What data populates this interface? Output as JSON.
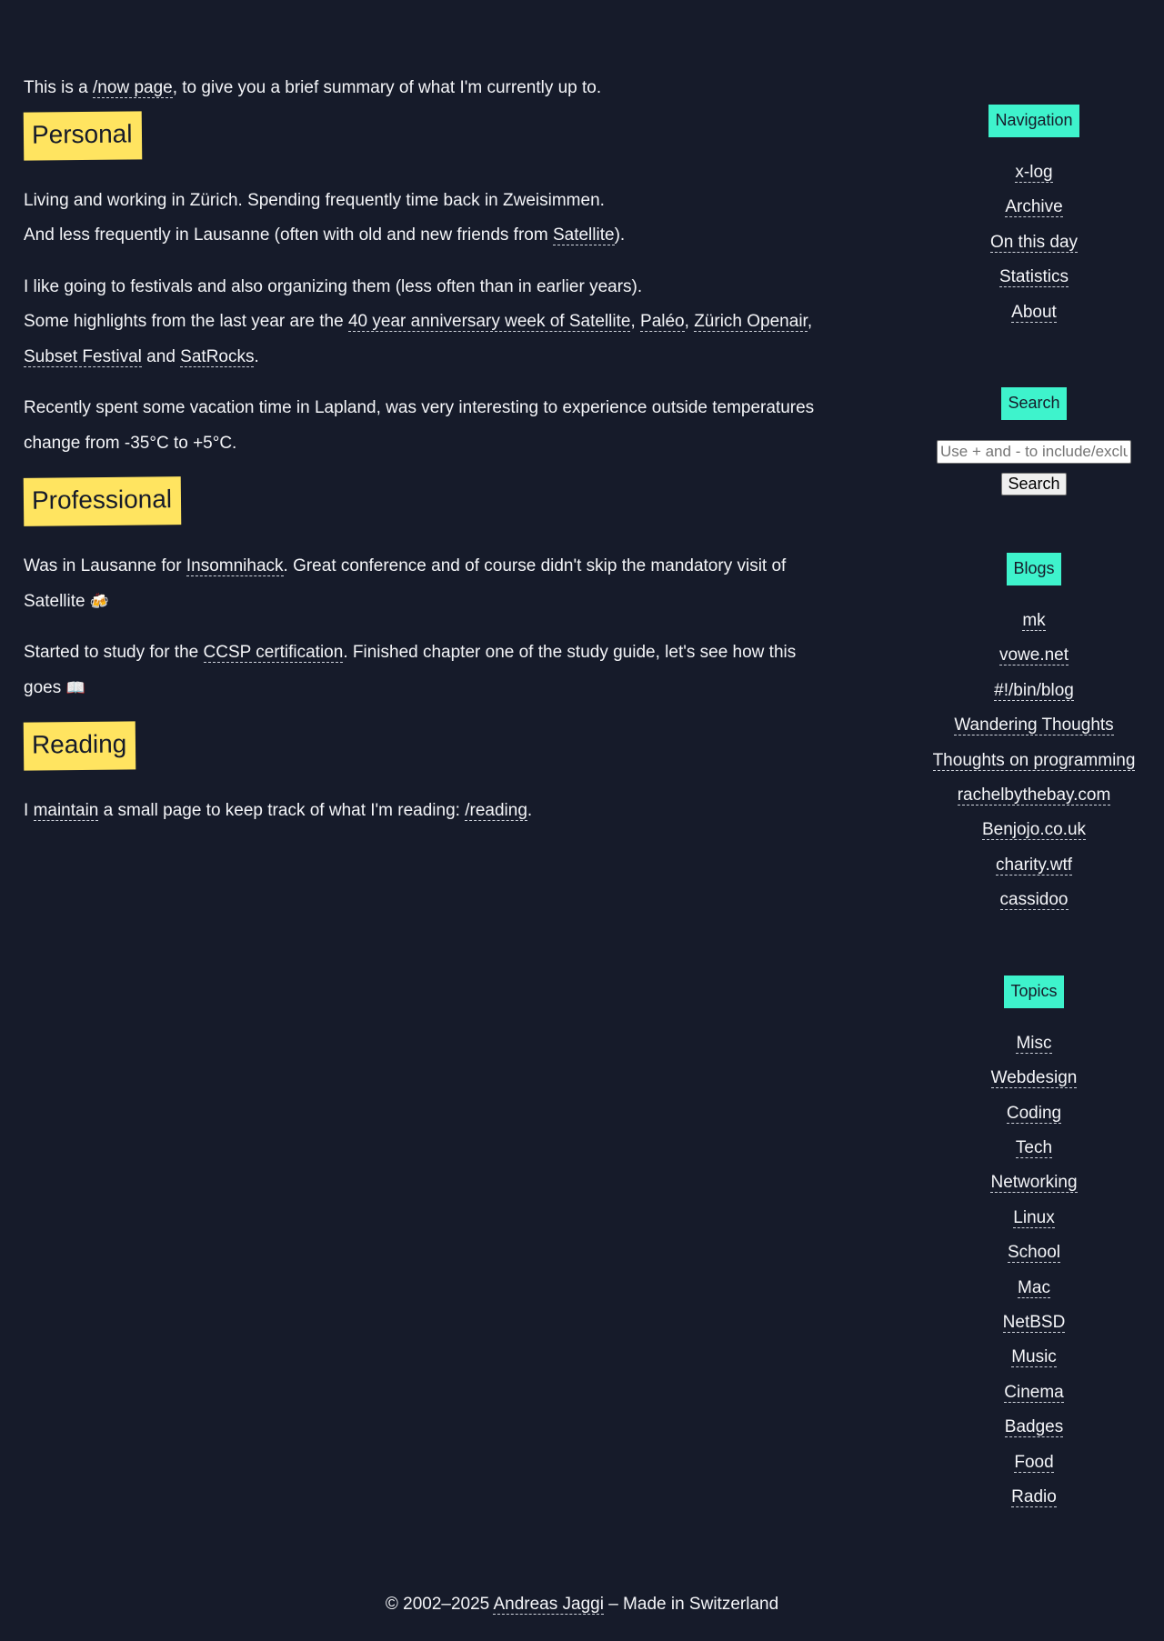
{
  "intro": {
    "text_before": "This is a ",
    "now_link": "/now page",
    "text_after": ", to give you a brief summary of what I'm currently up to."
  },
  "personal": {
    "heading": "Personal",
    "p1_line1": "Living and working in Zürich. Spending frequently time back in Zweisimmen.",
    "p1_line2_before": "And less frequently in Lausanne (often with old and new friends from ",
    "p1_satellite_link": "Satellite",
    "p1_line2_after": ").",
    "p2_line1": "I like going to festivals and also organizing them (less often than in earlier years).",
    "p2_text_before": "Some highlights from the last year are the ",
    "p2_link_anniversary": "40 year anniversary week of Satellite",
    "p2_sep1": ", ",
    "p2_link_paleo": "Paléo",
    "p2_sep2": ", ",
    "p2_link_zurich_openair": "Zürich Openair",
    "p2_sep3": ", ",
    "p2_link_subset": "Subset Festival",
    "p2_and": " and ",
    "p2_link_satrocks": "SatRocks",
    "p2_end": ".",
    "p3": "Recently spent some vacation time in Lapland, was very interesting to experience outside temperatures change from -35°C to +5°C."
  },
  "professional": {
    "heading": "Professional",
    "p1_before": "Was in Lausanne for ",
    "p1_link_insomnihack": "Insomnihack",
    "p1_after": ". Great conference and of course didn't skip the mandatory visit of Satellite ",
    "p1_emoji": "🍻",
    "p2_before": "Started to study for the ",
    "p2_link_ccsp": "CCSP certification",
    "p2_after": ". Finished chapter one of the study guide, let's see how this goes ",
    "p2_emoji": "📖"
  },
  "reading": {
    "heading": "Reading",
    "p1_before": "I ",
    "p1_link_maintain": "maintain",
    "p1_middle": " a small page to keep track of what I'm reading: ",
    "p1_link_reading": "/reading",
    "p1_end": "."
  },
  "sidebar": {
    "navigation": {
      "title": "Navigation",
      "items": [
        "x-log",
        "Archive",
        "On this day",
        "Statistics",
        "About"
      ]
    },
    "search": {
      "title": "Search",
      "placeholder": "Use + and - to include/exclude",
      "button_label": "Search"
    },
    "blogs": {
      "title": "Blogs",
      "items": [
        "mk",
        "vowe.net",
        "#!/bin/blog",
        "Wandering Thoughts",
        "Thoughts on programming",
        "rachelbythebay.com",
        "Benjojo.co.uk",
        "charity.wtf",
        "cassidoo"
      ]
    },
    "topics": {
      "title": "Topics",
      "items": [
        "Misc",
        "Webdesign",
        "Coding",
        "Tech",
        "Networking",
        "Linux",
        "School",
        "Mac",
        "NetBSD",
        "Music",
        "Cinema",
        "Badges",
        "Food",
        "Radio"
      ]
    }
  },
  "footer": {
    "copyright": "© 2002–2025 ",
    "author_link": "Andreas Jaggi",
    "tagline": " – Made in Switzerland"
  },
  "colors": {
    "background": "#161b2a",
    "text": "#f4f5f8",
    "heading_highlight": "#ffe460",
    "sidebar_title_highlight": "#3ef3cc"
  }
}
